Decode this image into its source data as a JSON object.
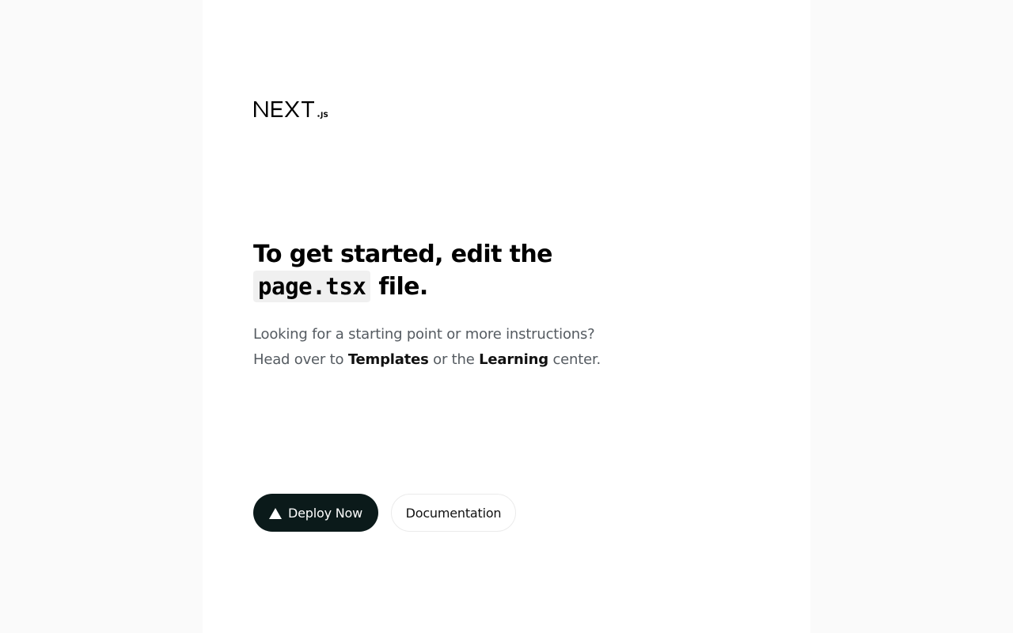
{
  "logo": {
    "icon": "nextjs-logo-icon"
  },
  "hero": {
    "headline_before": "To get started, edit the ",
    "code": "page.tsx",
    "headline_after": " file."
  },
  "intro": {
    "line1": "Looking for a starting point or more instructions?",
    "head_over": "Head over to ",
    "templates_link": "Templates",
    "or_the": " or the ",
    "learning_link": "Learning",
    "center": " center."
  },
  "actions": {
    "deploy_label": "Deploy Now",
    "deploy_icon": "vercel-triangle-icon",
    "docs_label": "Documentation"
  },
  "colors": {
    "background": "#fafafa",
    "panel": "#ffffff",
    "primary_button": "#0b1a1a",
    "muted_text": "#555b61"
  }
}
